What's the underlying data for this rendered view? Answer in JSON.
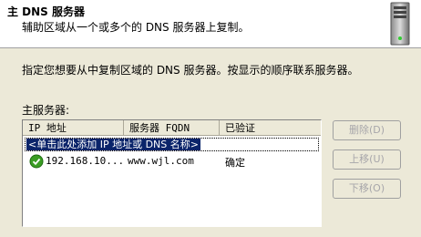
{
  "header": {
    "title": "主 DNS 服务器",
    "subtitle": "辅助区域从一个或多个的 DNS 服务器上复制。"
  },
  "instruction": "指定您想要从中复制区域的 DNS 服务器。按显示的顺序联系服务器。",
  "master_servers": {
    "label": "主服务器:",
    "columns": [
      "IP 地址",
      "服务器 FQDN",
      "已验证"
    ],
    "add_entry_text": "<单击此处添加 IP 地址或 DNS 名称>",
    "rows": [
      {
        "ip": "192.168.10...",
        "fqdn": "www.wjl.com",
        "verified": "确定",
        "status_icon": "check-icon"
      }
    ]
  },
  "buttons": {
    "delete": "删除(D)",
    "move_up": "上移(U)",
    "move_down": "下移(O)"
  },
  "colors": {
    "selection_bg": "#0a246a",
    "disabled_text": "#a7a6aa",
    "dialog_bg": "#ece9d8"
  }
}
